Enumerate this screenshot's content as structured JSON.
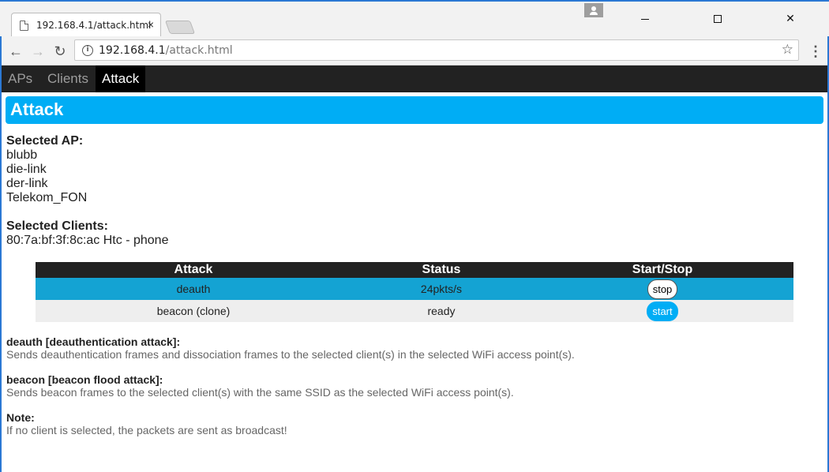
{
  "browser": {
    "tab_title": "192.168.4.1/attack.html",
    "tab_close": "×",
    "url_host": "192.168.4.1",
    "url_path": "/attack.html",
    "info_glyph": "i",
    "star_glyph": "☆",
    "menu_glyph": "⋮",
    "back_glyph": "←",
    "forward_glyph": "→",
    "reload_glyph": "↻",
    "close_glyph": "✕"
  },
  "nav": {
    "items": [
      {
        "label": "APs"
      },
      {
        "label": "Clients"
      },
      {
        "label": "Attack"
      }
    ],
    "active": "Attack"
  },
  "page": {
    "title": "Attack",
    "selected_ap_label": "Selected AP:",
    "selected_aps": [
      "blubb",
      "die-link",
      "der-link",
      "Telekom_FON"
    ],
    "selected_clients_label": "Selected Clients:",
    "selected_clients": [
      "80:7a:bf:3f:8c:ac Htc - phone"
    ]
  },
  "attack_table": {
    "headers": [
      "Attack",
      "Status",
      "Start/Stop"
    ],
    "rows": [
      {
        "attack": "deauth",
        "status": "24pkts/s",
        "button": "stop"
      },
      {
        "attack": "beacon (clone)",
        "status": "ready",
        "button": "start"
      }
    ]
  },
  "descriptions": [
    {
      "title": "deauth [deauthentication attack]:",
      "body": "Sends deauthentication frames and dissociation frames to the selected client(s) in the selected WiFi access point(s)."
    },
    {
      "title": "beacon [beacon flood attack]:",
      "body": "Sends beacon frames to the selected client(s) with the same SSID as the selected WiFi access point(s)."
    },
    {
      "title": "Note:",
      "body": "If no client is selected, the packets are sent as broadcast!"
    }
  ],
  "colors": {
    "accent": "#00adf5",
    "nav_bg": "#222222",
    "active_row": "#14a3d3",
    "status_running": "#e0303d",
    "status_ready": "#35b536"
  }
}
